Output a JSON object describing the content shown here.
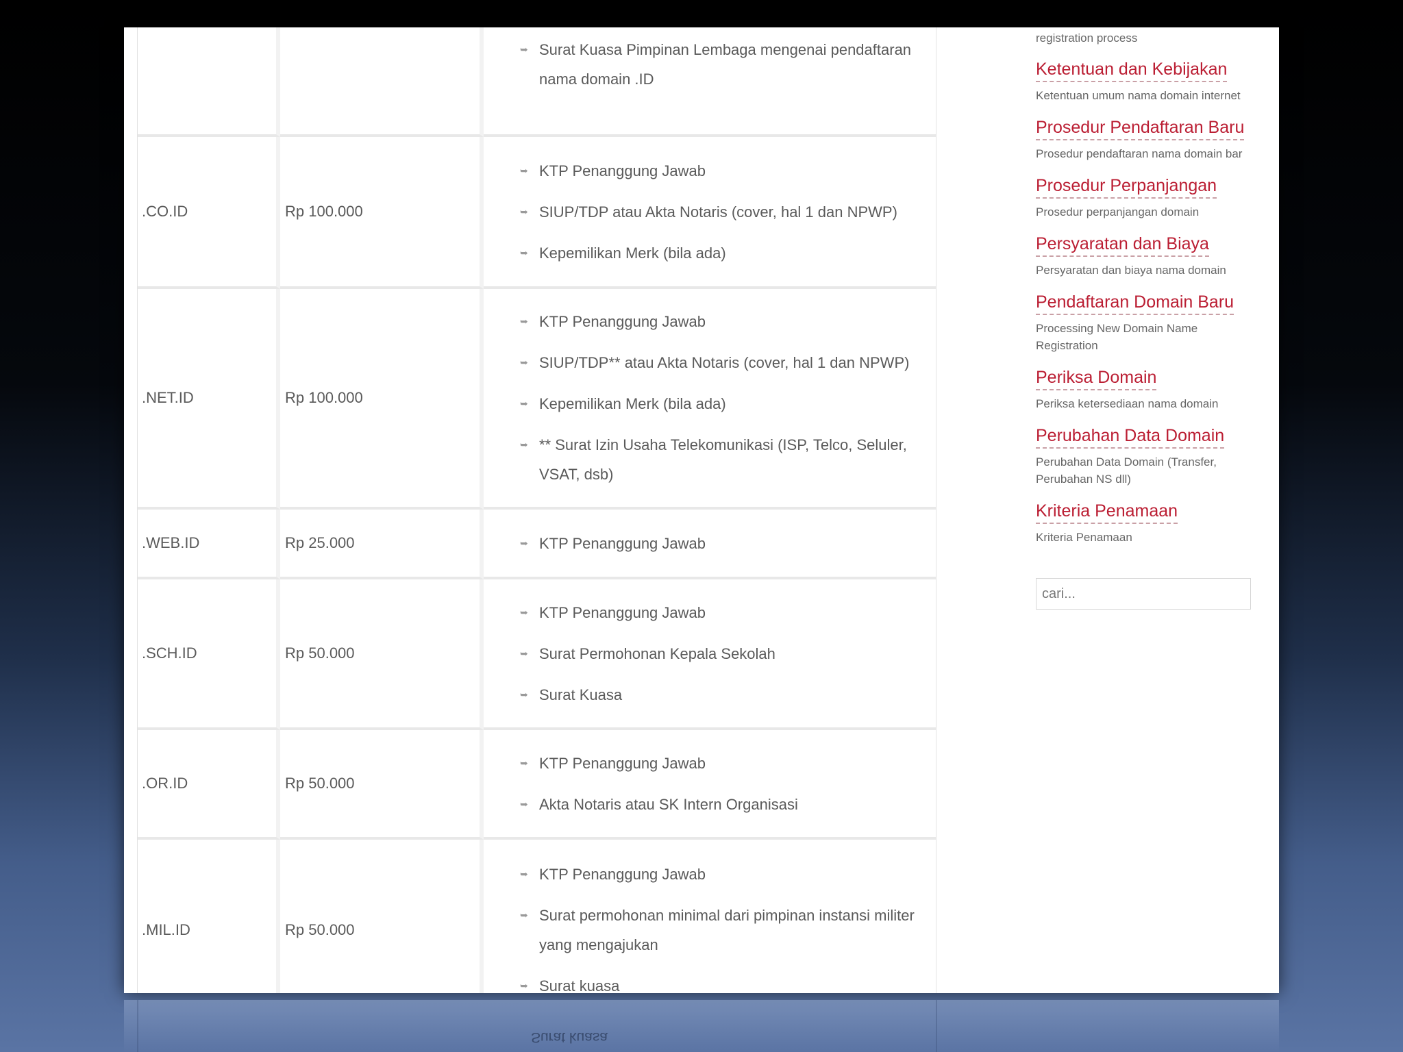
{
  "table": {
    "partial_first_row": {
      "requirements": [
        "Surat Kuasa Pimpinan Lembaga mengenai pendaftaran nama domain .ID"
      ]
    },
    "rows": [
      {
        "domain": ".CO.ID",
        "price": "Rp 100.000",
        "requirements": [
          "KTP Penanggung Jawab",
          "SIUP/TDP atau Akta Notaris (cover, hal 1 dan NPWP)",
          "Kepemilikan Merk (bila ada)"
        ]
      },
      {
        "domain": ".NET.ID",
        "price": "Rp 100.000",
        "requirements": [
          "KTP Penanggung Jawab",
          "SIUP/TDP** atau Akta Notaris (cover, hal 1 dan NPWP)",
          "Kepemilikan Merk (bila ada)",
          "** Surat Izin Usaha Telekomunikasi (ISP, Telco, Seluler, VSAT, dsb)"
        ]
      },
      {
        "domain": ".WEB.ID",
        "price": "Rp 25.000",
        "requirements": [
          "KTP Penanggung Jawab"
        ]
      },
      {
        "domain": ".SCH.ID",
        "price": "Rp 50.000",
        "requirements": [
          "KTP Penanggung Jawab",
          "Surat Permohonan Kepala Sekolah",
          "Surat Kuasa"
        ]
      },
      {
        "domain": ".OR.ID",
        "price": "Rp 50.000",
        "requirements": [
          "KTP Penanggung Jawab",
          "Akta Notaris atau SK Intern Organisasi"
        ]
      },
      {
        "domain": ".MIL.ID",
        "price": "Rp 50.000",
        "requirements": [
          "KTP Penanggung Jawab",
          "Surat permohonan minimal dari pimpinan instansi militer yang mengajukan",
          "Surat kuasa"
        ]
      }
    ]
  },
  "sidebar": {
    "top_note": "registration process",
    "items": [
      {
        "title": "Ketentuan dan Kebijakan",
        "desc": "Ketentuan umum nama domain internet"
      },
      {
        "title": "Prosedur Pendaftaran Baru",
        "desc": "Prosedur pendaftaran nama domain bar"
      },
      {
        "title": "Prosedur Perpanjangan",
        "desc": "Prosedur perpanjangan domain"
      },
      {
        "title": "Persyaratan dan Biaya",
        "desc": "Persyaratan dan biaya nama domain"
      },
      {
        "title": "Pendaftaran Domain Baru",
        "desc": "Processing New Domain Name Registration"
      },
      {
        "title": "Periksa Domain",
        "desc": "Periksa ketersediaan nama domain"
      },
      {
        "title": "Perubahan Data Domain",
        "desc": "Perubahan Data Domain (Transfer, Perubahan NS dll)"
      },
      {
        "title": "Kriteria Penamaan",
        "desc": "Kriteria Penamaan"
      }
    ],
    "search_placeholder": "cari..."
  },
  "reflection": {
    "text": "Surat kuasa"
  },
  "icons": {
    "bullet": "bullet-arrow-icon"
  }
}
